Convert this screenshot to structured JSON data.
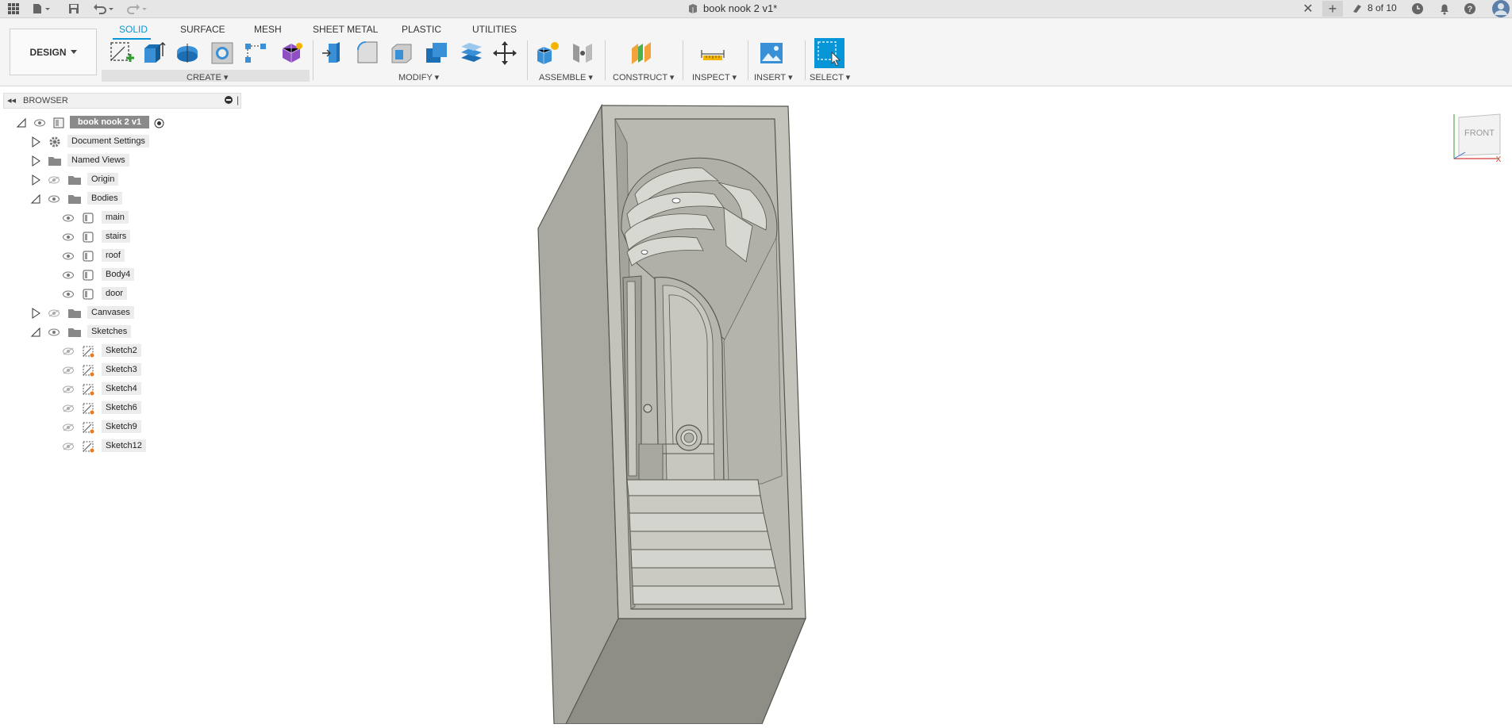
{
  "topbar": {
    "document_title": "book nook 2 v1*",
    "job_status": "8 of 10",
    "icons": [
      "grid-icon",
      "file-menu-icon",
      "save-icon",
      "undo-icon",
      "redo-icon",
      "close-tab-icon",
      "new-tab-icon",
      "job-status-icon",
      "clock-icon",
      "bell-icon",
      "help-icon",
      "avatar-icon"
    ]
  },
  "ribbon": {
    "workspace": "DESIGN",
    "tabs": [
      {
        "label": "SOLID",
        "active": true
      },
      {
        "label": "SURFACE",
        "active": false
      },
      {
        "label": "MESH",
        "active": false
      },
      {
        "label": "SHEET METAL",
        "active": false
      },
      {
        "label": "PLASTIC",
        "active": false
      },
      {
        "label": "UTILITIES",
        "active": false
      }
    ],
    "groups": {
      "create": "CREATE",
      "modify": "MODIFY",
      "assemble": "ASSEMBLE",
      "construct": "CONSTRUCT",
      "inspect": "INSPECT",
      "insert": "INSERT",
      "select": "SELECT"
    }
  },
  "browser": {
    "title": "BROWSER",
    "root": "book nook 2 v1",
    "items": {
      "document_settings": "Document Settings",
      "named_views": "Named Views",
      "origin": "Origin",
      "bodies": "Bodies",
      "canvases": "Canvases",
      "sketches": "Sketches"
    },
    "bodies": [
      "main",
      "stairs",
      "roof",
      "Body4",
      "door"
    ],
    "sketches": [
      "Sketch2",
      "Sketch3",
      "Sketch4",
      "Sketch6",
      "Sketch9",
      "Sketch12"
    ]
  },
  "viewcube": {
    "face": "FRONT",
    "axis_x": "X"
  },
  "colors": {
    "accent": "#0696d7",
    "model": "#b4b4ac",
    "model_dark": "#8e8e86",
    "model_light": "#c9c9c1"
  }
}
